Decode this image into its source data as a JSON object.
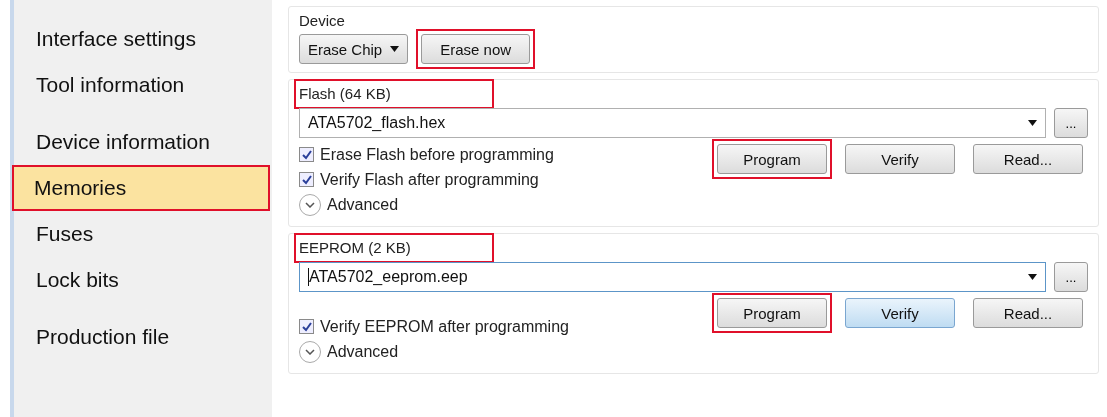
{
  "sidebar": {
    "sections": [
      {
        "items": [
          {
            "label": "Interface settings",
            "selected": false,
            "marked": false
          },
          {
            "label": "Tool information",
            "selected": false,
            "marked": false
          }
        ]
      },
      {
        "items": [
          {
            "label": "Device information",
            "selected": false,
            "marked": false
          },
          {
            "label": "Memories",
            "selected": true,
            "marked": true
          },
          {
            "label": "Fuses",
            "selected": false,
            "marked": false
          },
          {
            "label": "Lock bits",
            "selected": false,
            "marked": false
          }
        ]
      },
      {
        "items": [
          {
            "label": "Production file",
            "selected": false,
            "marked": false
          }
        ]
      }
    ]
  },
  "device": {
    "title": "Device",
    "dropdown": "Erase Chip",
    "button": {
      "label": "Erase now",
      "marked": true
    }
  },
  "memories": [
    {
      "title": "Flash (64 KB)",
      "marked": true,
      "file": "ATA5702_flash.hex",
      "focused": false,
      "browse": "...",
      "options": [
        {
          "label": "Erase Flash before programming",
          "checked": true
        },
        {
          "label": "Verify Flash after programming",
          "checked": true
        }
      ],
      "advanced": "Advanced",
      "buttons": [
        {
          "label": "Program",
          "marked": true,
          "focused": false
        },
        {
          "label": "Verify",
          "marked": false,
          "focused": false
        },
        {
          "label": "Read...",
          "marked": false,
          "focused": false
        }
      ]
    },
    {
      "title": "EEPROM (2 KB)",
      "marked": true,
      "file": "ATA5702_eeprom.eep",
      "focused": true,
      "browse": "...",
      "options": [
        {
          "label": "Verify EEPROM after programming",
          "checked": true
        }
      ],
      "advanced": "Advanced",
      "buttons": [
        {
          "label": "Program",
          "marked": true,
          "focused": false
        },
        {
          "label": "Verify",
          "marked": false,
          "focused": true
        },
        {
          "label": "Read...",
          "marked": false,
          "focused": false
        }
      ]
    }
  ]
}
